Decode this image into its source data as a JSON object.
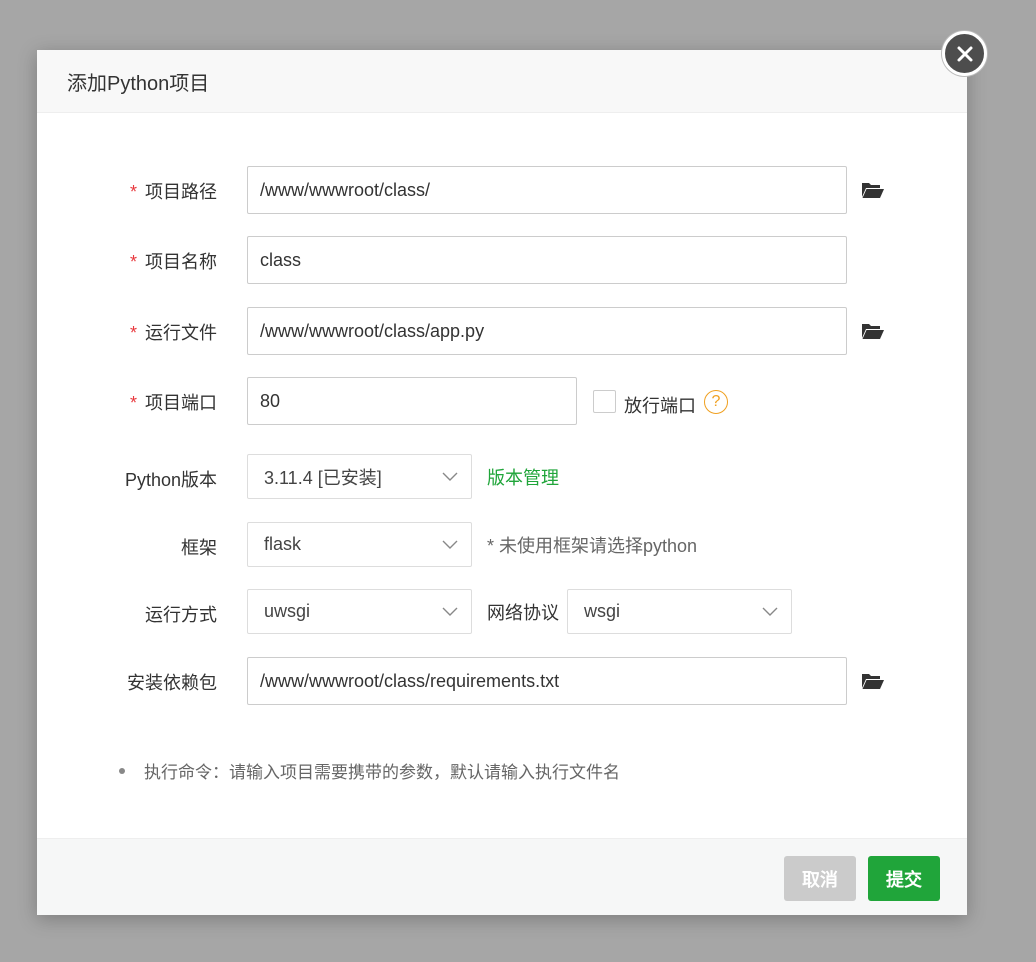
{
  "dialog": {
    "title": "添加Python项目"
  },
  "form": {
    "project_path": {
      "label": "项目路径",
      "value": "/www/wwwroot/class/",
      "required_mark": "*"
    },
    "project_name": {
      "label": "项目名称",
      "value": "class",
      "required_mark": "*"
    },
    "run_file": {
      "label": "运行文件",
      "value": "/www/wwwroot/class/app.py",
      "required_mark": "*"
    },
    "project_port": {
      "label": "项目端口",
      "value": "80",
      "required_mark": "*",
      "open_port_label": "放行端口",
      "help_icon": "?"
    },
    "python_version": {
      "label": "Python版本",
      "selected": "3.11.4 [已安装]",
      "manage_link": "版本管理"
    },
    "framework": {
      "label": "框架",
      "selected": "flask",
      "hint": "* 未使用框架请选择python"
    },
    "run_mode": {
      "label": "运行方式",
      "selected": "uwsgi",
      "protocol_label": "网络协议",
      "protocol_selected": "wsgi"
    },
    "requirements": {
      "label": "安装依赖包",
      "value": "/www/wwwroot/class/requirements.txt"
    }
  },
  "tip": "执行命令：请输入项目需要携带的参数，默认请输入执行文件名",
  "footer": {
    "cancel_label": "取消",
    "submit_label": "提交"
  },
  "colors": {
    "accent": "#20a53a",
    "required": "#e8383d",
    "help": "#f0a020"
  }
}
